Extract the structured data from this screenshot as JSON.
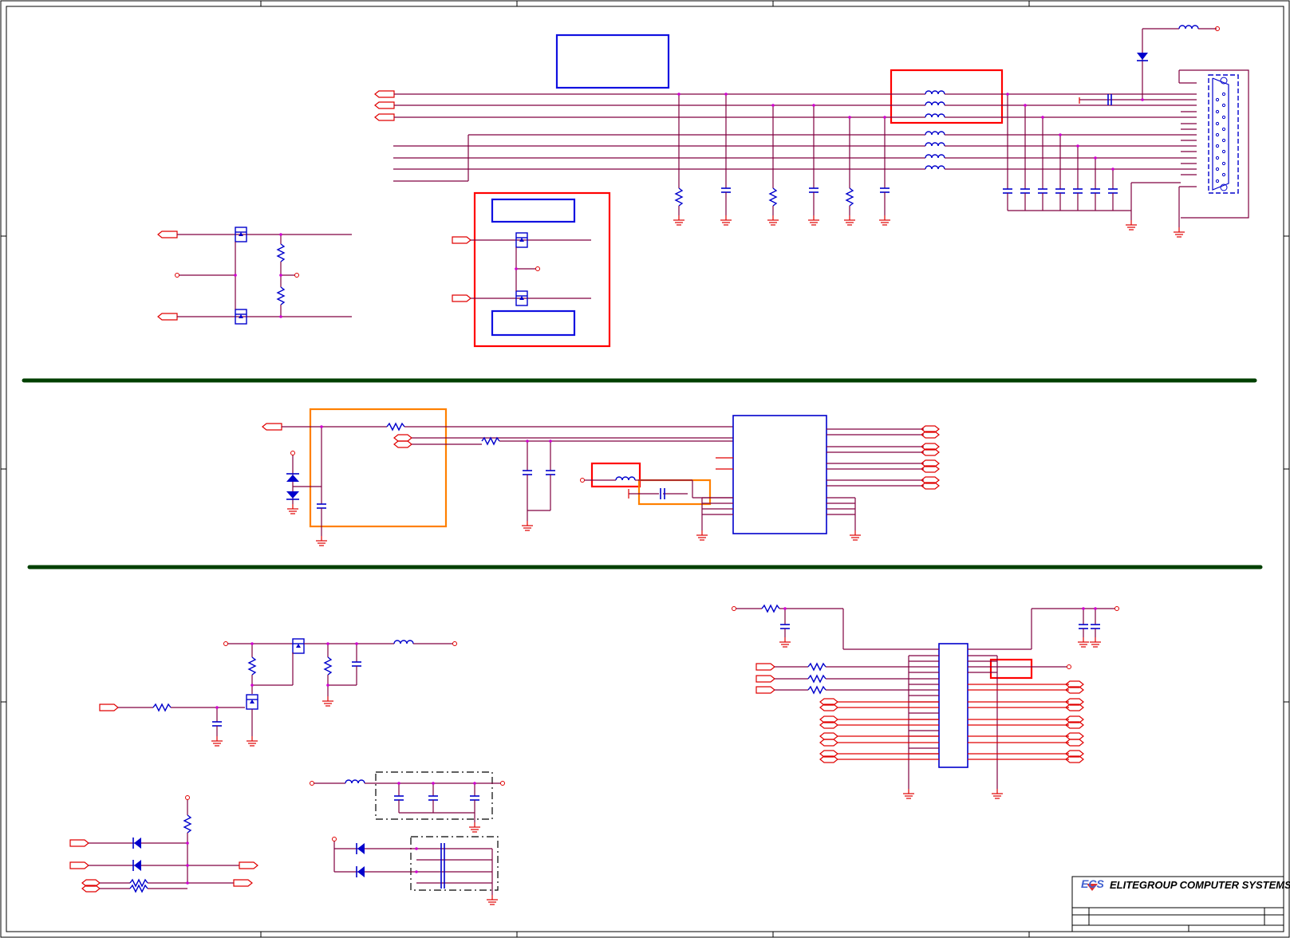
{
  "title_block": {
    "logo_text": "ECS",
    "company_name": "ELITEGROUP COMPUTER SYSTEMS"
  },
  "colors": {
    "net_wire": "#800040",
    "connector": "#e00000",
    "component": "#0000cc",
    "highlight_red": "#ff0000",
    "highlight_orange": "#ff8000",
    "section_divider": "#004000",
    "junction": "#d000d0"
  }
}
